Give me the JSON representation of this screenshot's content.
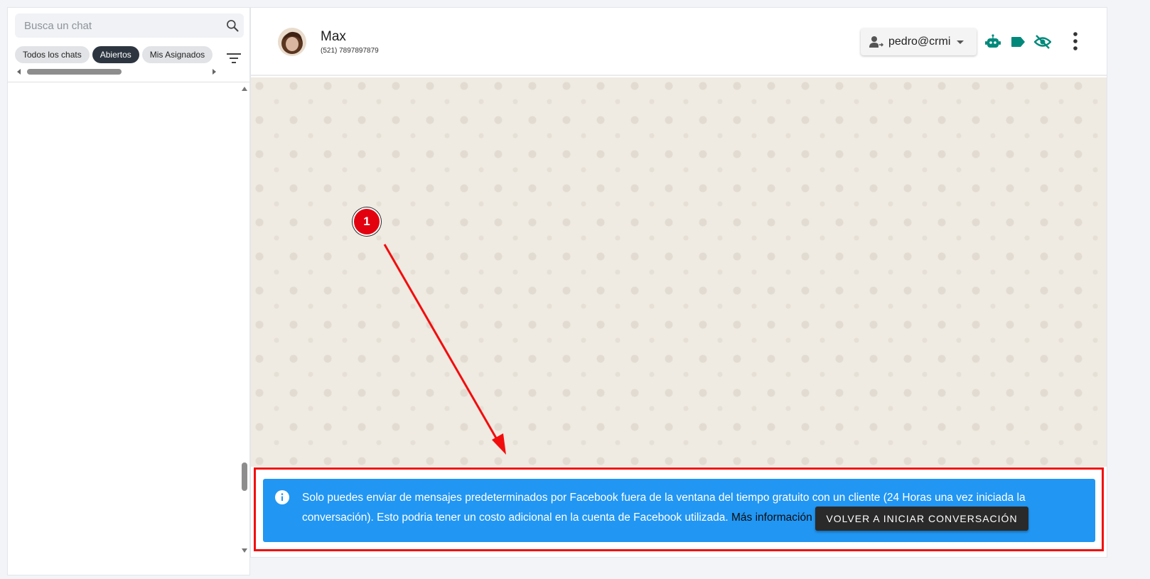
{
  "sidebar": {
    "search": {
      "placeholder": "Busca un chat"
    },
    "filters": [
      "Todos los chats",
      "Abiertos",
      "Mis Asignados"
    ],
    "active_filter": "Abiertos"
  },
  "header": {
    "contact": {
      "name": "Max",
      "phone": "(521) 7897897879"
    },
    "agent": {
      "label": "pedro@crmi"
    },
    "icons": [
      "robot-icon",
      "label-icon",
      "eye-off-icon",
      "more-vert-icon"
    ]
  },
  "notice": {
    "text": "Solo puedes enviar de mensajes predeterminados por Facebook fuera de la ventana del tiempo gratuito con un cliente (24 Horas una vez iniciada la conversación). Esto podria tener un costo adicional en la cuenta de Facebook utilizada.",
    "link": "Más información",
    "button": "VOLVER A INICIAR CONVERSACIÓN"
  },
  "annotation": {
    "step": "1"
  },
  "colors": {
    "accent": "#00897b",
    "notice_bg": "#2196f3",
    "annotation_red": "#f20d0d",
    "chip_active": "#2d3640"
  }
}
